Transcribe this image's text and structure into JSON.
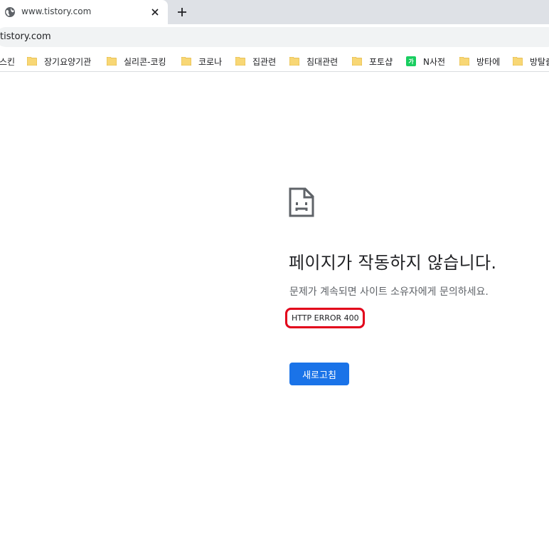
{
  "browser": {
    "tab": {
      "title": "www.tistory.com",
      "favicon": "globe-icon",
      "close": "close-icon"
    },
    "new_tab": "plus-icon",
    "address_bar": {
      "url": "tistory.com"
    },
    "bookmarks": [
      {
        "label": "스킨",
        "icon": "folder-icon"
      },
      {
        "label": "장기요양기관",
        "icon": "folder-icon"
      },
      {
        "label": "실리콘-코킹",
        "icon": "folder-icon"
      },
      {
        "label": "코로나",
        "icon": "folder-icon"
      },
      {
        "label": "집관련",
        "icon": "folder-icon"
      },
      {
        "label": "침대관련",
        "icon": "folder-icon"
      },
      {
        "label": "포토샵",
        "icon": "folder-icon"
      },
      {
        "label": "N사전",
        "icon": "naver-dictionary-icon",
        "icon_text": "가"
      },
      {
        "label": "방타에",
        "icon": "folder-icon"
      },
      {
        "label": "방탈출",
        "icon": "folder-icon"
      }
    ]
  },
  "error_page": {
    "icon": "sad-page-icon",
    "heading": "페이지가 작동하지 않습니다.",
    "subtext": "문제가 계속되면 사이트 소유자에게 문의하세요.",
    "error_code": "HTTP ERROR 400",
    "reload_label": "새로고침"
  },
  "colors": {
    "accent": "#1a73e8",
    "highlight": "#e2001a",
    "folder": "#f8d775",
    "naver": "#19ce60"
  }
}
